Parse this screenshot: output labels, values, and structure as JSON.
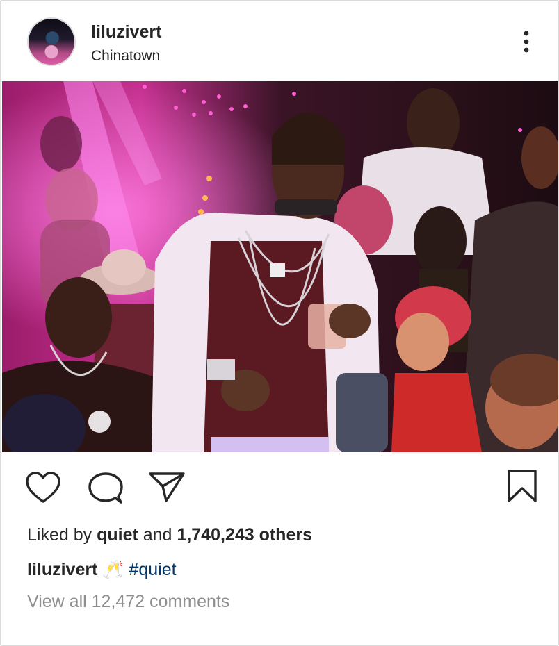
{
  "post": {
    "header": {
      "username": "liluzivert",
      "location": "Chinatown",
      "avatar_icon": "profile-avatar",
      "more_icon": "more-vertical-icon"
    },
    "image": {
      "description_icon": "party-photo",
      "palette": {
        "magenta": "#d6249f",
        "pink_light": "#ff7ec2",
        "dark": "#160812"
      }
    },
    "actions": {
      "like_icon": "heart-icon",
      "comment_icon": "comment-icon",
      "share_icon": "send-icon",
      "save_icon": "bookmark-icon"
    },
    "likes": {
      "prefix": "Liked by",
      "user": "quiet",
      "middle": "and",
      "count": "1,740,243 others"
    },
    "caption": {
      "user": "liluzivert",
      "emoji": "🥂",
      "hashtag": "#quiet"
    },
    "comments_link": "View all 12,472 comments",
    "colors": {
      "text": "#262626",
      "secondary": "#8e8e8e",
      "link": "#00376b",
      "border": "#dbdbdb"
    }
  }
}
